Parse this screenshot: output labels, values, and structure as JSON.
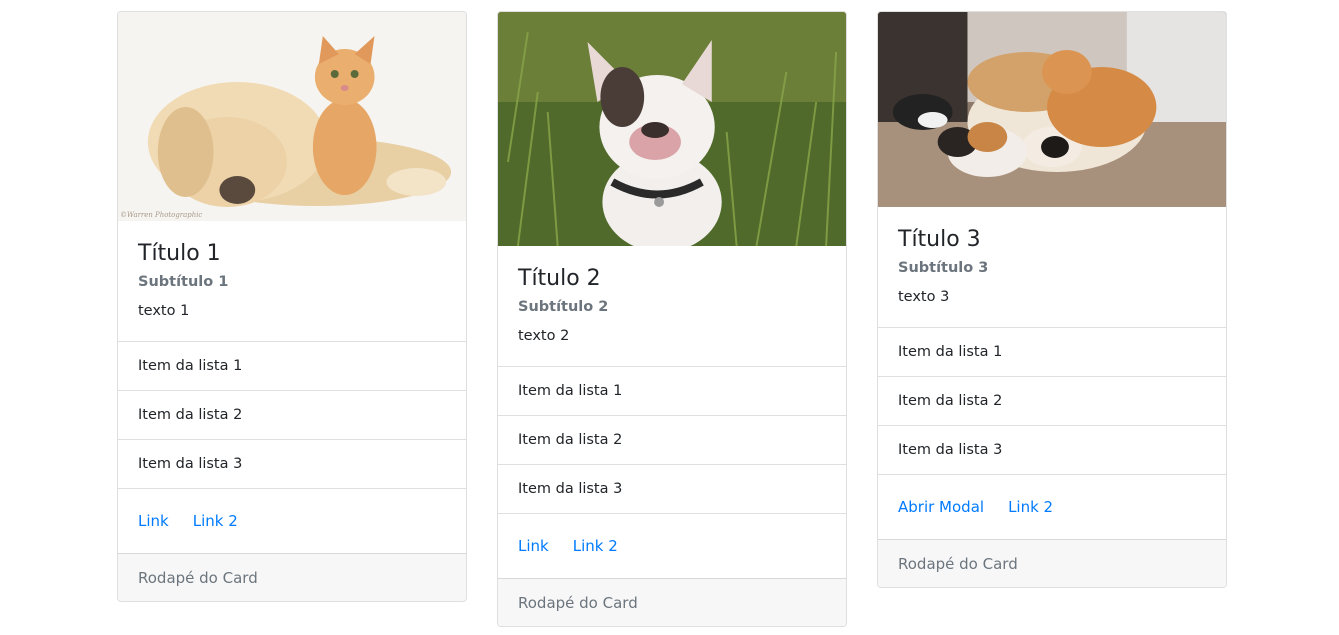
{
  "cards": [
    {
      "image_alt": "dog-and-kitten-photo",
      "title": "Título 1",
      "subtitle": "Subtítulo 1",
      "text": "texto 1",
      "list": [
        "Item da lista 1",
        "Item da lista 2",
        "Item da lista 3"
      ],
      "links": [
        "Link",
        "Link 2"
      ],
      "footer": "Rodapé do Card",
      "image_watermark": "©Warren Photographic"
    },
    {
      "image_alt": "bulldog-in-grass-photo",
      "title": "Título 2",
      "subtitle": "Subtítulo 2",
      "text": "texto 2",
      "list": [
        "Item da lista 1",
        "Item da lista 2",
        "Item da lista 3"
      ],
      "links": [
        "Link",
        "Link 2"
      ],
      "footer": "Rodapé do Card"
    },
    {
      "image_alt": "dog-and-cats-sleeping-photo",
      "title": "Título 3",
      "subtitle": "Subtítulo 3",
      "text": "texto 3",
      "list": [
        "Item da lista 1",
        "Item da lista 2",
        "Item da lista 3"
      ],
      "links": [
        "Abrir Modal",
        "Link 2"
      ],
      "footer": "Rodapé do Card"
    }
  ],
  "colors": {
    "link": "#007bff",
    "muted": "#6c757d",
    "footer_bg": "#f7f7f7",
    "border": "rgba(0,0,0,0.125)"
  }
}
